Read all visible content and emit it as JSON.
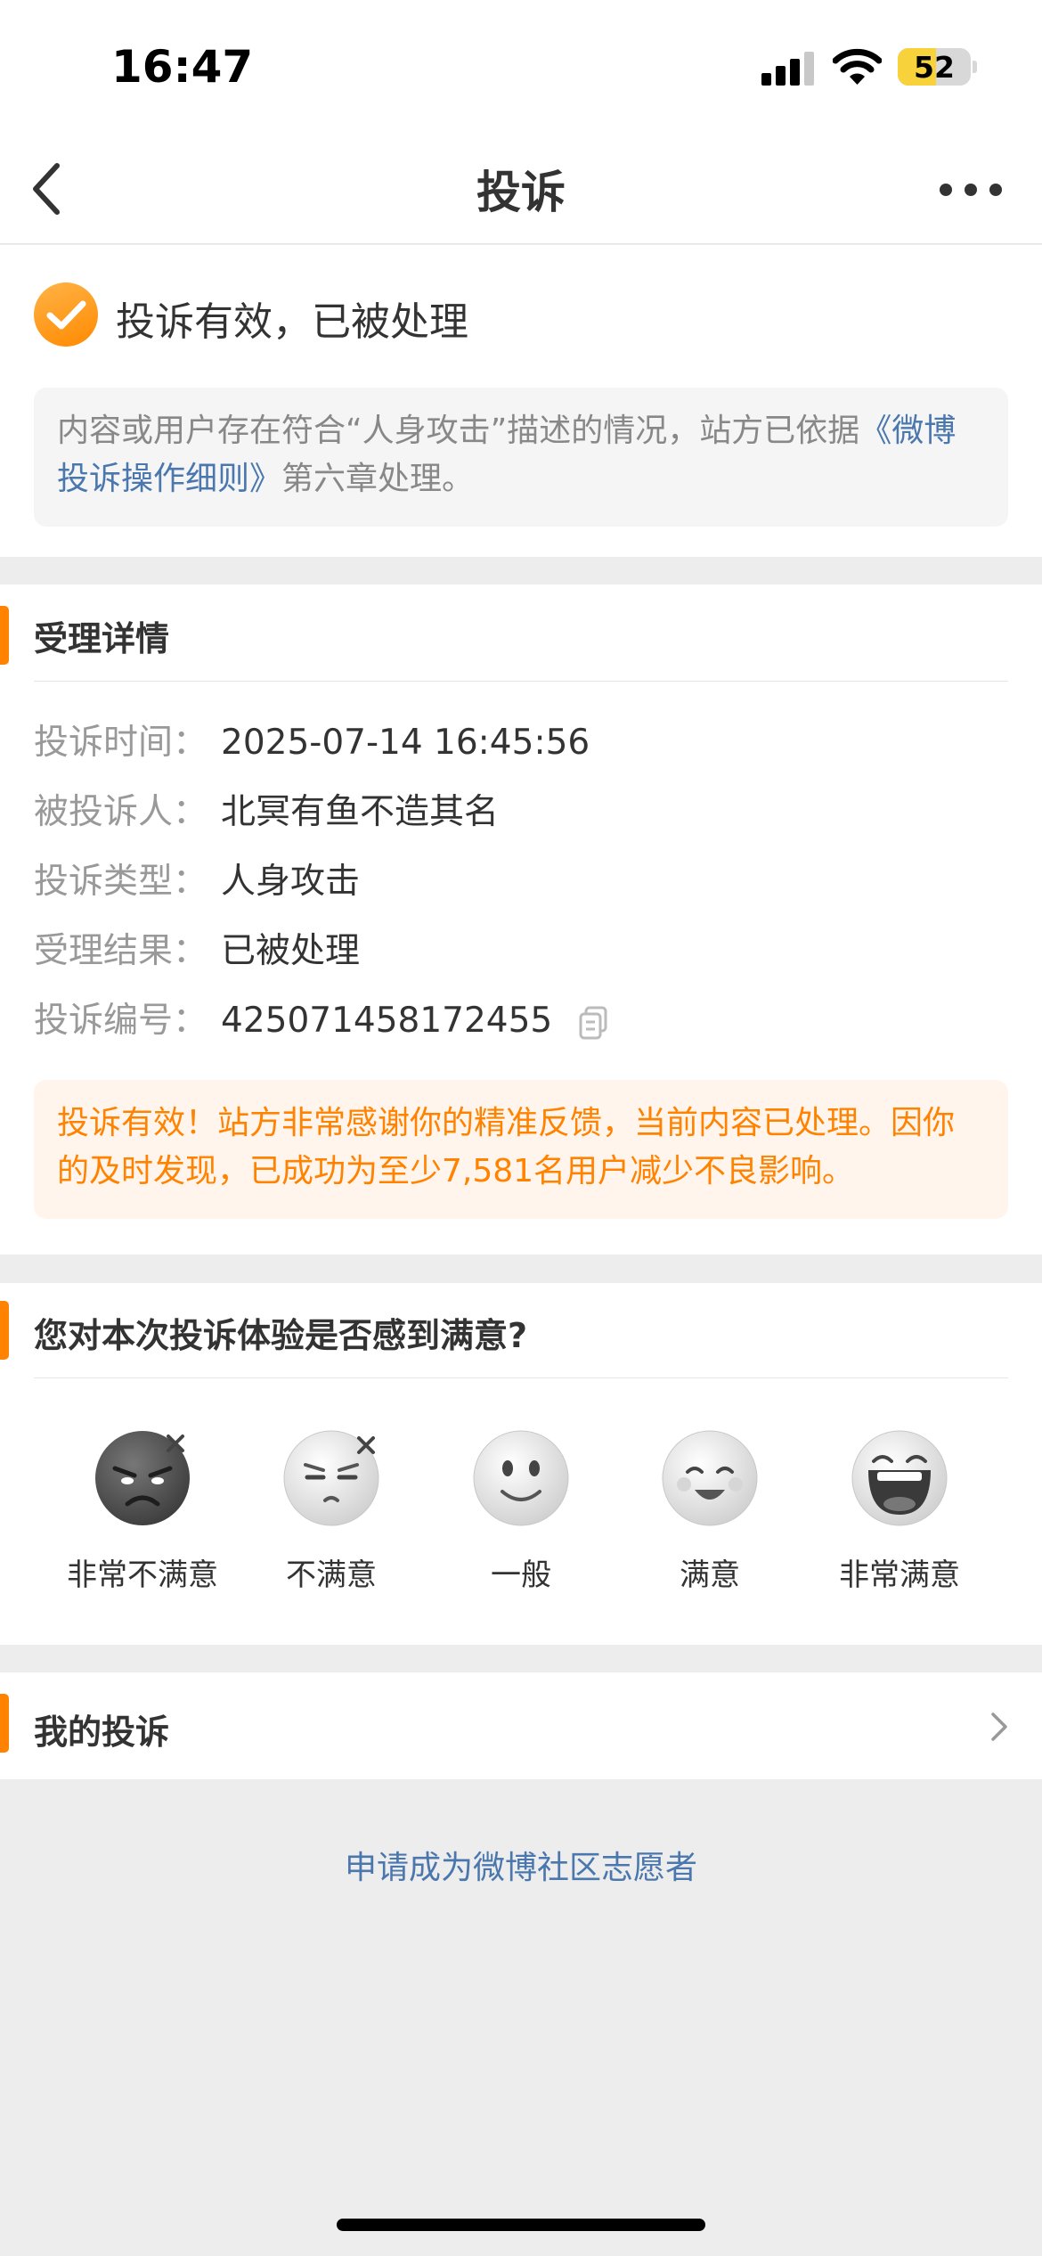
{
  "status_bar": {
    "time": "16:47",
    "battery": "52",
    "battery_level": 0.52
  },
  "nav": {
    "title": "投诉"
  },
  "result": {
    "title": "投诉有效，已被处理",
    "notice_text": "内容或用户存在符合“人身攻击”描述的情况，站方已依据",
    "notice_link": "《微博投诉操作细则》",
    "notice_suffix": "第六章处理。"
  },
  "detail": {
    "section_title": "受理详情",
    "rows": [
      {
        "label": "投诉时间：",
        "value": "2025-07-14 16:45:56"
      },
      {
        "label": "被投诉人：",
        "value": "北冥有鱼不造其名"
      },
      {
        "label": "投诉类型：",
        "value": "人身攻击"
      },
      {
        "label": "受理结果：",
        "value": "已被处理"
      },
      {
        "label": "投诉编号：",
        "value": "425071458172455"
      }
    ],
    "thanks_text": "投诉有效！站方非常感谢你的精准反馈，当前内容已处理。因你的及时发现，已成功为至少7,581名用户减少不良影响。"
  },
  "satisfaction": {
    "title": "您对本次投诉体验是否感到满意?",
    "options": [
      {
        "label": "非常不满意",
        "icon": "very-angry-face-icon"
      },
      {
        "label": "不满意",
        "icon": "annoyed-face-icon"
      },
      {
        "label": "一般",
        "icon": "neutral-face-icon"
      },
      {
        "label": "满意",
        "icon": "smiling-face-icon"
      },
      {
        "label": "非常满意",
        "icon": "laughing-face-icon"
      }
    ]
  },
  "my_complaints": {
    "label": "我的投诉"
  },
  "volunteer": {
    "label": "申请成为微博社区志愿者"
  },
  "colors": {
    "accent": "#ff8200",
    "link": "#4a77ad",
    "background": "#ededed"
  }
}
